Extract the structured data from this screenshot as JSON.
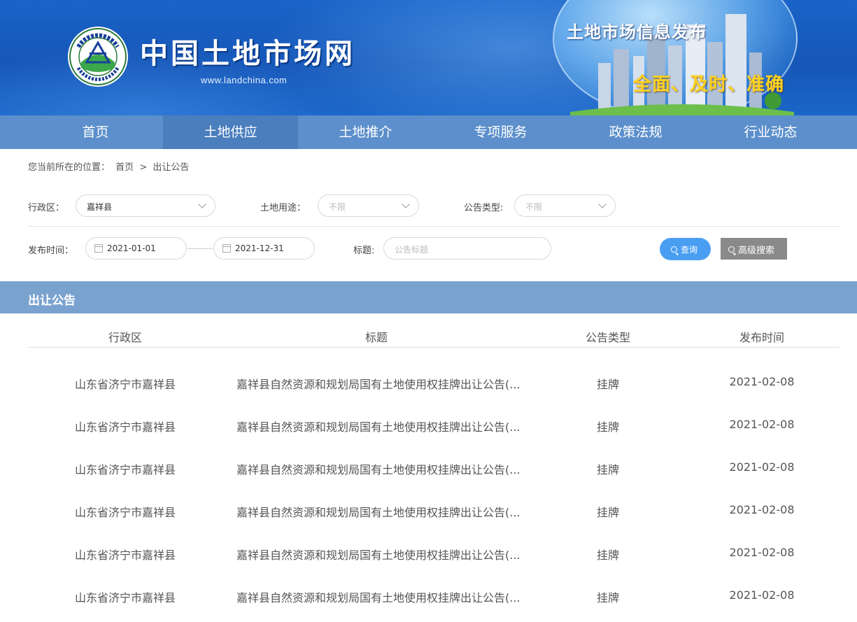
{
  "header": {
    "site_name": "中国土地市场网",
    "site_url": "www.landchina.com",
    "slogan_1": "土地市场信息发布",
    "slogan_2": "全面、及时、准确",
    "logo_ring_text": "中国土地市场网 WWW.LANDCHINA.COM",
    "brand_color": "#1a63c8"
  },
  "nav": {
    "items": [
      {
        "label": "首页"
      },
      {
        "label": "土地供应"
      },
      {
        "label": "土地推介"
      },
      {
        "label": "专项服务"
      },
      {
        "label": "政策法规"
      },
      {
        "label": "行业动态"
      }
    ],
    "active_index": 1
  },
  "breadcrumb": {
    "prefix": "您当前所在的位置：",
    "home": "首页",
    "separator": ">",
    "current": "出让公告"
  },
  "filters": {
    "region_label": "行政区：",
    "region_value": "嘉祥县",
    "land_use_label": "土地用途：",
    "land_use_placeholder": "不限",
    "notice_type_label": "公告类型:",
    "notice_type_placeholder": "不限",
    "publish_time_label": "发布时间：",
    "date_start": "2021-01-01",
    "date_end": "2021-12-31",
    "title_label": "标题:",
    "title_placeholder": "公告标题",
    "query_button": "查询",
    "advanced_button": "高级搜索"
  },
  "section": {
    "title": "出让公告"
  },
  "table": {
    "columns": [
      "行政区",
      "标题",
      "公告类型",
      "发布时间"
    ],
    "rows": [
      {
        "region": "山东省济宁市嘉祥县",
        "title": "嘉祥县自然资源和规划局国有土地使用权挂牌出让公告(...",
        "type": "挂牌",
        "date": "2021-02-08"
      },
      {
        "region": "山东省济宁市嘉祥县",
        "title": "嘉祥县自然资源和规划局国有土地使用权挂牌出让公告(...",
        "type": "挂牌",
        "date": "2021-02-08"
      },
      {
        "region": "山东省济宁市嘉祥县",
        "title": "嘉祥县自然资源和规划局国有土地使用权挂牌出让公告(...",
        "type": "挂牌",
        "date": "2021-02-08"
      },
      {
        "region": "山东省济宁市嘉祥县",
        "title": "嘉祥县自然资源和规划局国有土地使用权挂牌出让公告(...",
        "type": "挂牌",
        "date": "2021-02-08"
      },
      {
        "region": "山东省济宁市嘉祥县",
        "title": "嘉祥县自然资源和规划局国有土地使用权挂牌出让公告(...",
        "type": "挂牌",
        "date": "2021-02-08"
      },
      {
        "region": "山东省济宁市嘉祥县",
        "title": "嘉祥县自然资源和规划局国有土地使用权挂牌出让公告(...",
        "type": "挂牌",
        "date": "2021-02-08"
      }
    ]
  }
}
